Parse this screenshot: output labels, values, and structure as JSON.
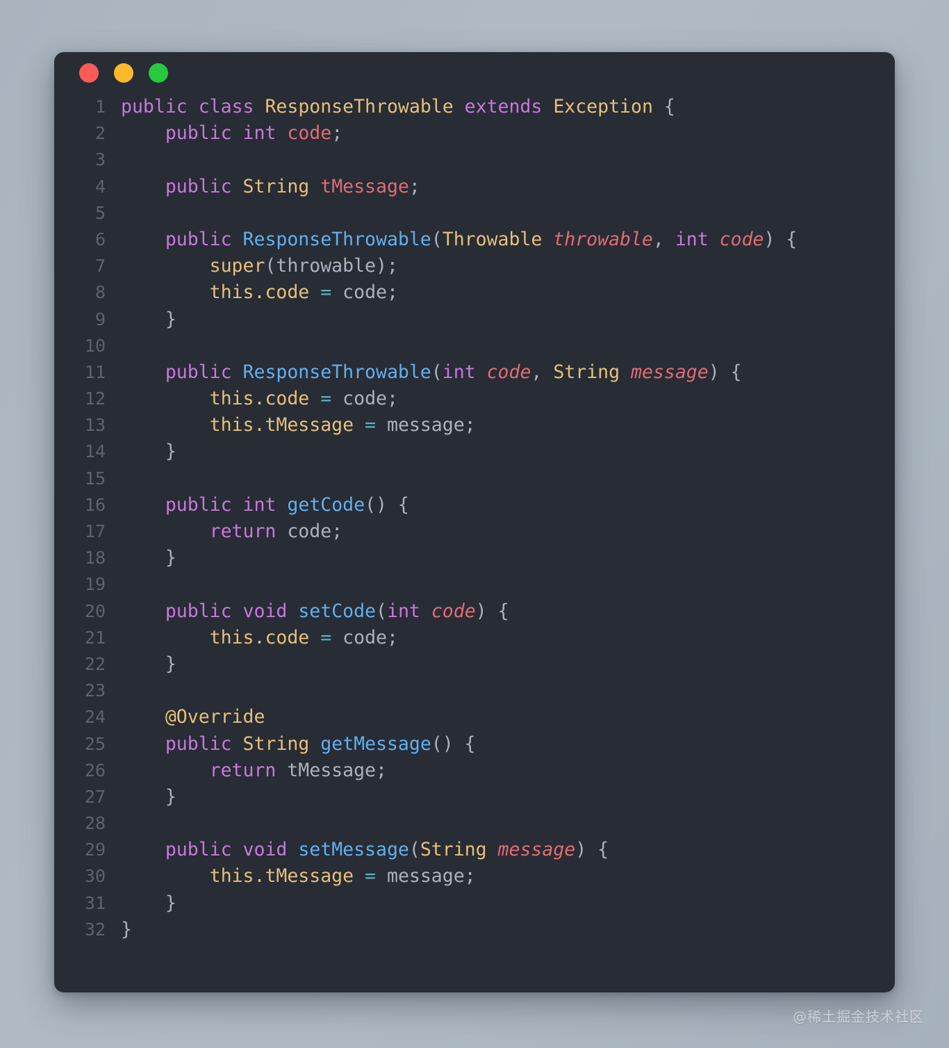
{
  "window": {
    "background_color": "#282c34",
    "page_background_color": "#adb8c3",
    "controls": [
      {
        "name": "close",
        "color": "#fc5b57"
      },
      {
        "name": "minimize",
        "color": "#fcb92b"
      },
      {
        "name": "maximize",
        "color": "#27c93f"
      }
    ]
  },
  "watermark": {
    "text": "@稀土掘金技术社区"
  },
  "editor": {
    "language": "java",
    "line_count": 32,
    "theme_colors": {
      "keyword": "#c678dd",
      "type": "#e5c07b",
      "function": "#61afef",
      "variable": "#e06c75",
      "parameter": "#e06c75",
      "this_keyword": "#e5c07b",
      "operator": "#56b6c2",
      "plain": "#abb2bf",
      "line_number": "#5c6370"
    },
    "lines": [
      {
        "n": "1",
        "tokens": [
          {
            "t": "public",
            "c": "kw"
          },
          {
            "t": " ",
            "c": "pl"
          },
          {
            "t": "class",
            "c": "kw"
          },
          {
            "t": " ",
            "c": "pl"
          },
          {
            "t": "ResponseThrowable",
            "c": "type"
          },
          {
            "t": " ",
            "c": "pl"
          },
          {
            "t": "extends",
            "c": "kw"
          },
          {
            "t": " ",
            "c": "pl"
          },
          {
            "t": "Exception",
            "c": "type"
          },
          {
            "t": " {",
            "c": "pl"
          }
        ]
      },
      {
        "n": "2",
        "tokens": [
          {
            "t": "    ",
            "c": "pl"
          },
          {
            "t": "public",
            "c": "kw"
          },
          {
            "t": " ",
            "c": "pl"
          },
          {
            "t": "int",
            "c": "kw"
          },
          {
            "t": " ",
            "c": "pl"
          },
          {
            "t": "code",
            "c": "var"
          },
          {
            "t": ";",
            "c": "pl"
          }
        ]
      },
      {
        "n": "3",
        "tokens": []
      },
      {
        "n": "4",
        "tokens": [
          {
            "t": "    ",
            "c": "pl"
          },
          {
            "t": "public",
            "c": "kw"
          },
          {
            "t": " ",
            "c": "pl"
          },
          {
            "t": "String",
            "c": "type"
          },
          {
            "t": " ",
            "c": "pl"
          },
          {
            "t": "tMessage",
            "c": "var"
          },
          {
            "t": ";",
            "c": "pl"
          }
        ]
      },
      {
        "n": "5",
        "tokens": []
      },
      {
        "n": "6",
        "tokens": [
          {
            "t": "    ",
            "c": "pl"
          },
          {
            "t": "public",
            "c": "kw"
          },
          {
            "t": " ",
            "c": "pl"
          },
          {
            "t": "ResponseThrowable",
            "c": "fn"
          },
          {
            "t": "(",
            "c": "pl"
          },
          {
            "t": "Throwable",
            "c": "type"
          },
          {
            "t": " ",
            "c": "pl"
          },
          {
            "t": "throwable",
            "c": "parm"
          },
          {
            "t": ", ",
            "c": "pl"
          },
          {
            "t": "int",
            "c": "kw"
          },
          {
            "t": " ",
            "c": "pl"
          },
          {
            "t": "code",
            "c": "parm"
          },
          {
            "t": ") {",
            "c": "pl"
          }
        ]
      },
      {
        "n": "7",
        "tokens": [
          {
            "t": "        ",
            "c": "pl"
          },
          {
            "t": "super",
            "c": "this"
          },
          {
            "t": "(throwable);",
            "c": "pl"
          }
        ]
      },
      {
        "n": "8",
        "tokens": [
          {
            "t": "        ",
            "c": "pl"
          },
          {
            "t": "this",
            "c": "this"
          },
          {
            "t": ".",
            "c": "this"
          },
          {
            "t": "code",
            "c": "this"
          },
          {
            "t": " ",
            "c": "pl"
          },
          {
            "t": "=",
            "c": "op"
          },
          {
            "t": " ",
            "c": "pl"
          },
          {
            "t": "code;",
            "c": "pl"
          }
        ]
      },
      {
        "n": "9",
        "tokens": [
          {
            "t": "    }",
            "c": "pl"
          }
        ]
      },
      {
        "n": "10",
        "tokens": []
      },
      {
        "n": "11",
        "tokens": [
          {
            "t": "    ",
            "c": "pl"
          },
          {
            "t": "public",
            "c": "kw"
          },
          {
            "t": " ",
            "c": "pl"
          },
          {
            "t": "ResponseThrowable",
            "c": "fn"
          },
          {
            "t": "(",
            "c": "pl"
          },
          {
            "t": "int",
            "c": "kw"
          },
          {
            "t": " ",
            "c": "pl"
          },
          {
            "t": "code",
            "c": "parm"
          },
          {
            "t": ", ",
            "c": "pl"
          },
          {
            "t": "String",
            "c": "type"
          },
          {
            "t": " ",
            "c": "pl"
          },
          {
            "t": "message",
            "c": "parm"
          },
          {
            "t": ") {",
            "c": "pl"
          }
        ]
      },
      {
        "n": "12",
        "tokens": [
          {
            "t": "        ",
            "c": "pl"
          },
          {
            "t": "this",
            "c": "this"
          },
          {
            "t": ".",
            "c": "this"
          },
          {
            "t": "code",
            "c": "this"
          },
          {
            "t": " ",
            "c": "pl"
          },
          {
            "t": "=",
            "c": "op"
          },
          {
            "t": " ",
            "c": "pl"
          },
          {
            "t": "code;",
            "c": "pl"
          }
        ]
      },
      {
        "n": "13",
        "tokens": [
          {
            "t": "        ",
            "c": "pl"
          },
          {
            "t": "this",
            "c": "this"
          },
          {
            "t": ".",
            "c": "this"
          },
          {
            "t": "tMessage",
            "c": "this"
          },
          {
            "t": " ",
            "c": "pl"
          },
          {
            "t": "=",
            "c": "op"
          },
          {
            "t": " ",
            "c": "pl"
          },
          {
            "t": "message;",
            "c": "pl"
          }
        ]
      },
      {
        "n": "14",
        "tokens": [
          {
            "t": "    }",
            "c": "pl"
          }
        ]
      },
      {
        "n": "15",
        "tokens": []
      },
      {
        "n": "16",
        "tokens": [
          {
            "t": "    ",
            "c": "pl"
          },
          {
            "t": "public",
            "c": "kw"
          },
          {
            "t": " ",
            "c": "pl"
          },
          {
            "t": "int",
            "c": "kw"
          },
          {
            "t": " ",
            "c": "pl"
          },
          {
            "t": "getCode",
            "c": "fn"
          },
          {
            "t": "() {",
            "c": "pl"
          }
        ]
      },
      {
        "n": "17",
        "tokens": [
          {
            "t": "        ",
            "c": "pl"
          },
          {
            "t": "return",
            "c": "kw"
          },
          {
            "t": " ",
            "c": "pl"
          },
          {
            "t": "code;",
            "c": "pl"
          }
        ]
      },
      {
        "n": "18",
        "tokens": [
          {
            "t": "    }",
            "c": "pl"
          }
        ]
      },
      {
        "n": "19",
        "tokens": []
      },
      {
        "n": "20",
        "tokens": [
          {
            "t": "    ",
            "c": "pl"
          },
          {
            "t": "public",
            "c": "kw"
          },
          {
            "t": " ",
            "c": "pl"
          },
          {
            "t": "void",
            "c": "kw"
          },
          {
            "t": " ",
            "c": "pl"
          },
          {
            "t": "setCode",
            "c": "fn"
          },
          {
            "t": "(",
            "c": "pl"
          },
          {
            "t": "int",
            "c": "kw"
          },
          {
            "t": " ",
            "c": "pl"
          },
          {
            "t": "code",
            "c": "parm"
          },
          {
            "t": ") {",
            "c": "pl"
          }
        ]
      },
      {
        "n": "21",
        "tokens": [
          {
            "t": "        ",
            "c": "pl"
          },
          {
            "t": "this",
            "c": "this"
          },
          {
            "t": ".",
            "c": "this"
          },
          {
            "t": "code",
            "c": "this"
          },
          {
            "t": " ",
            "c": "pl"
          },
          {
            "t": "=",
            "c": "op"
          },
          {
            "t": " ",
            "c": "pl"
          },
          {
            "t": "code;",
            "c": "pl"
          }
        ]
      },
      {
        "n": "22",
        "tokens": [
          {
            "t": "    }",
            "c": "pl"
          }
        ]
      },
      {
        "n": "23",
        "tokens": []
      },
      {
        "n": "24",
        "tokens": [
          {
            "t": "    ",
            "c": "pl"
          },
          {
            "t": "@Override",
            "c": "this"
          }
        ]
      },
      {
        "n": "25",
        "tokens": [
          {
            "t": "    ",
            "c": "pl"
          },
          {
            "t": "public",
            "c": "kw"
          },
          {
            "t": " ",
            "c": "pl"
          },
          {
            "t": "String",
            "c": "type"
          },
          {
            "t": " ",
            "c": "pl"
          },
          {
            "t": "getMessage",
            "c": "fn"
          },
          {
            "t": "() {",
            "c": "pl"
          }
        ]
      },
      {
        "n": "26",
        "tokens": [
          {
            "t": "        ",
            "c": "pl"
          },
          {
            "t": "return",
            "c": "kw"
          },
          {
            "t": " ",
            "c": "pl"
          },
          {
            "t": "tMessage;",
            "c": "pl"
          }
        ]
      },
      {
        "n": "27",
        "tokens": [
          {
            "t": "    }",
            "c": "pl"
          }
        ]
      },
      {
        "n": "28",
        "tokens": []
      },
      {
        "n": "29",
        "tokens": [
          {
            "t": "    ",
            "c": "pl"
          },
          {
            "t": "public",
            "c": "kw"
          },
          {
            "t": " ",
            "c": "pl"
          },
          {
            "t": "void",
            "c": "kw"
          },
          {
            "t": " ",
            "c": "pl"
          },
          {
            "t": "setMessage",
            "c": "fn"
          },
          {
            "t": "(",
            "c": "pl"
          },
          {
            "t": "String",
            "c": "type"
          },
          {
            "t": " ",
            "c": "pl"
          },
          {
            "t": "message",
            "c": "parm"
          },
          {
            "t": ") {",
            "c": "pl"
          }
        ]
      },
      {
        "n": "30",
        "tokens": [
          {
            "t": "        ",
            "c": "pl"
          },
          {
            "t": "this",
            "c": "this"
          },
          {
            "t": ".",
            "c": "this"
          },
          {
            "t": "tMessage",
            "c": "this"
          },
          {
            "t": " ",
            "c": "pl"
          },
          {
            "t": "=",
            "c": "op"
          },
          {
            "t": " ",
            "c": "pl"
          },
          {
            "t": "message;",
            "c": "pl"
          }
        ]
      },
      {
        "n": "31",
        "tokens": [
          {
            "t": "    }",
            "c": "pl"
          }
        ]
      },
      {
        "n": "32",
        "tokens": [
          {
            "t": "}",
            "c": "pl"
          }
        ]
      }
    ]
  }
}
